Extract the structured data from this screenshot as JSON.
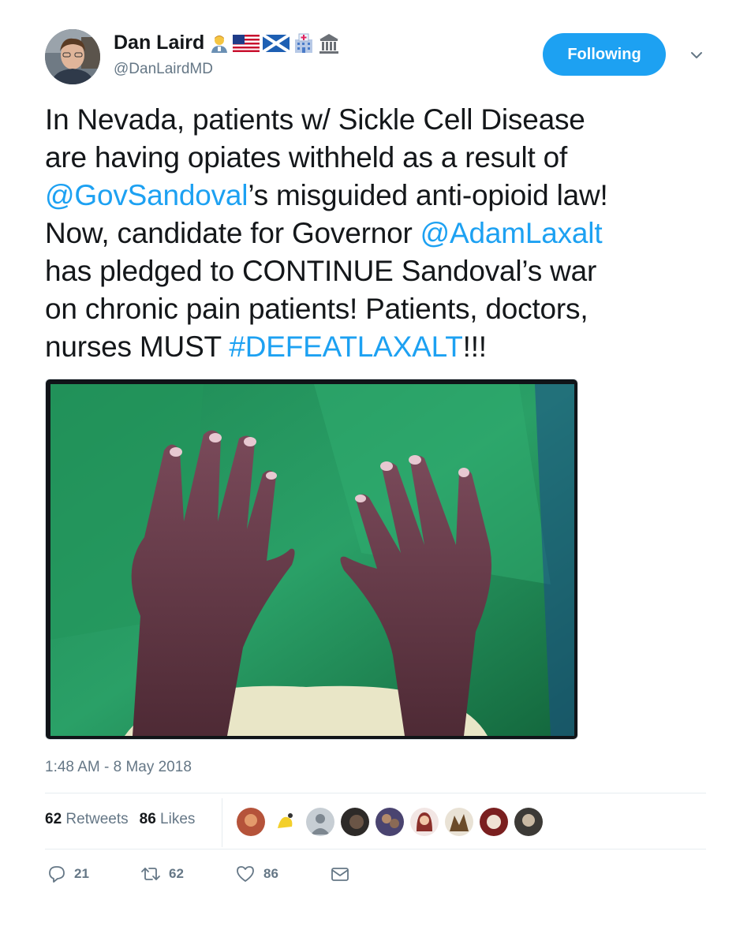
{
  "author": {
    "name": "Dan Laird",
    "handle": "@DanLairdMD",
    "name_emojis": [
      "man-health-worker",
      "us-flag",
      "scotland-flag",
      "hospital",
      "classical-building"
    ]
  },
  "follow_button": {
    "label": "Following"
  },
  "tweet": {
    "lines": [
      [
        {
          "text": "In Nevada, patients w/ Sickle Cell Disease",
          "link": false
        }
      ],
      [
        {
          "text": "are having opiates withheld as a result of",
          "link": false
        }
      ],
      [
        {
          "text": "@GovSandoval",
          "link": true
        },
        {
          "text": "’s misguided anti-opioid law!",
          "link": false
        }
      ],
      [
        {
          "text": "Now, candidate for Governor ",
          "link": false
        },
        {
          "text": "@AdamLaxalt",
          "link": true
        }
      ],
      [
        {
          "text": "has pledged to CONTINUE Sandoval’s war",
          "link": false
        }
      ],
      [
        {
          "text": "on chronic pain patients! Patients, doctors,",
          "link": false
        }
      ],
      [
        {
          "text": "nurses MUST ",
          "link": false
        },
        {
          "text": "#DEFEATLAXALT",
          "link": true
        },
        {
          "text": "!!!",
          "link": false
        }
      ]
    ]
  },
  "timestamp": "1:48 AM - 8 May 2018",
  "stats": {
    "retweets_count": "62",
    "retweets_label": "Retweets",
    "likes_count": "86",
    "likes_label": "Likes"
  },
  "actions": {
    "replies": "21",
    "retweets": "62",
    "likes": "86"
  },
  "colors": {
    "link": "#1da1f2",
    "button": "#1da1f2",
    "secondary_text": "#657786"
  },
  "icons": [
    "chevron-down-icon",
    "reply-icon",
    "retweet-icon",
    "heart-icon",
    "message-icon"
  ]
}
